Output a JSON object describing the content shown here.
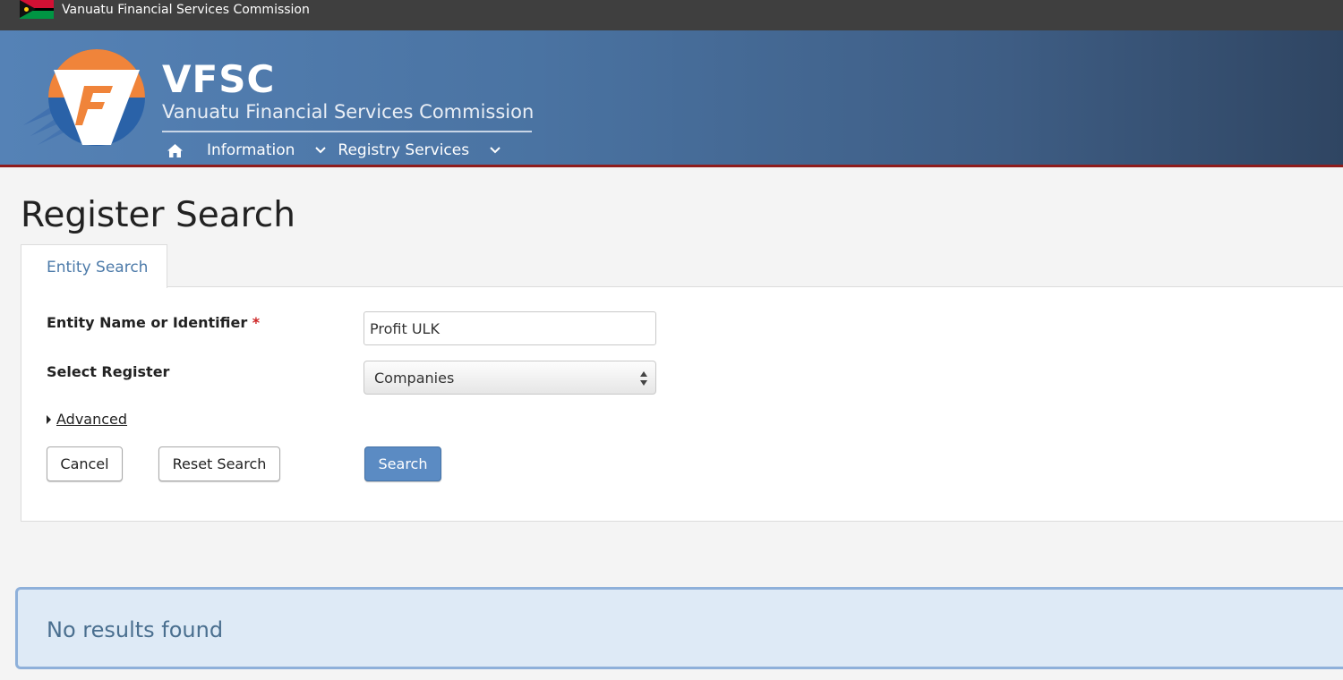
{
  "topbar": {
    "title": "Vanuatu Financial Services Commission"
  },
  "header": {
    "brand": "VFSC",
    "brand_sub": "Vanuatu Financial Services Commission",
    "nav": [
      {
        "label": "Information",
        "icon": "chevron-down-icon"
      },
      {
        "label": "Registry Services",
        "icon": "chevron-down-icon"
      }
    ],
    "home_icon": "home-icon"
  },
  "page": {
    "title": "Register Search"
  },
  "tabs": [
    {
      "label": "Entity Search",
      "active": true
    }
  ],
  "form": {
    "entity_label": "Entity Name or Identifier",
    "required_mark": "*",
    "entity_value": "Profit ULK",
    "register_label": "Select Register",
    "register_value": "Companies",
    "advanced_label": "Advanced",
    "cancel_label": "Cancel",
    "reset_label": "Reset Search",
    "search_label": "Search"
  },
  "alert": {
    "message": "No results found"
  },
  "colors": {
    "topbar": "#3f3f3f",
    "header_start": "#5582b6",
    "header_end": "#2f4562",
    "accent_red": "#8f1c1c",
    "logo_orange": "#f0843a",
    "primary_button": "#5b8bc3",
    "tab_text": "#4c7aa9",
    "alert_bg": "#deeaf6",
    "alert_border": "#8eb0da"
  }
}
